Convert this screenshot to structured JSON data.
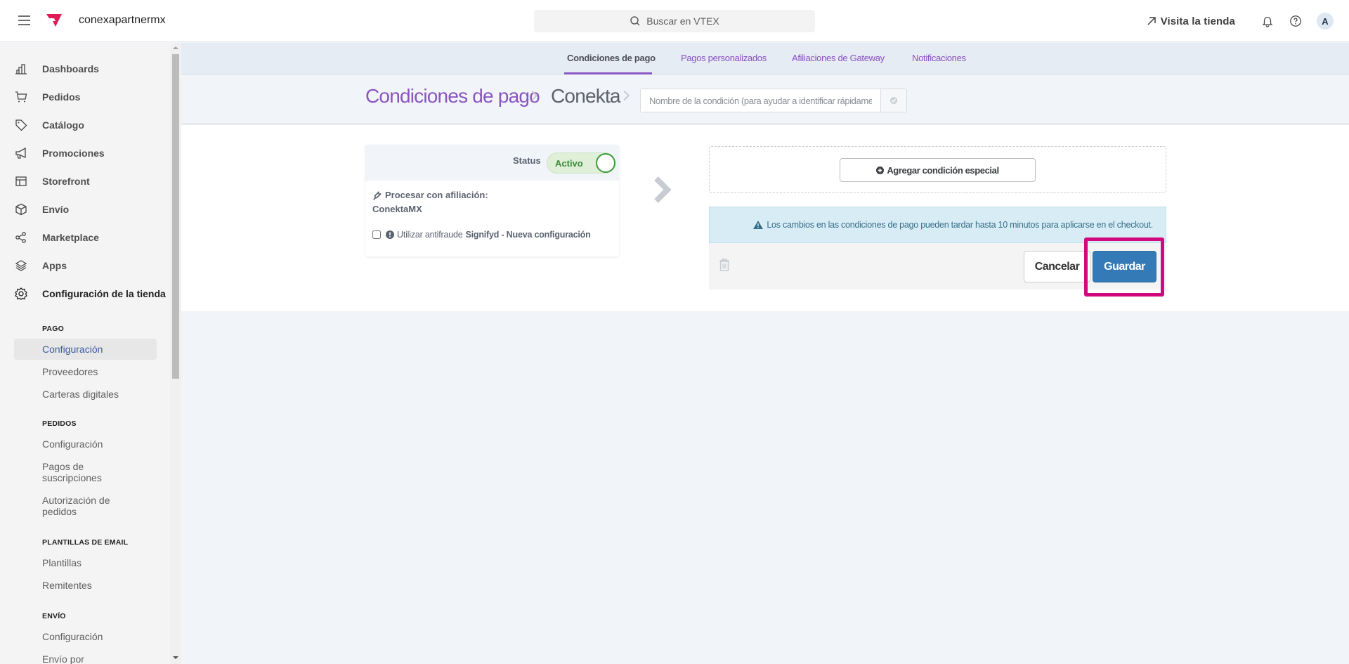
{
  "topbar": {
    "account_name": "conexapartnermx",
    "search_placeholder": "Buscar en VTEX",
    "visit_store_label": "Visita la tienda",
    "avatar_initial": "A",
    "brand_color": "#e31c58"
  },
  "sidebar": {
    "items": [
      {
        "label": "Dashboards",
        "icon": "bar-chart-icon"
      },
      {
        "label": "Pedidos",
        "icon": "cart-icon"
      },
      {
        "label": "Catálogo",
        "icon": "tag-icon"
      },
      {
        "label": "Promociones",
        "icon": "megaphone-icon"
      },
      {
        "label": "Storefront",
        "icon": "layout-icon"
      },
      {
        "label": "Envío",
        "icon": "box-icon"
      },
      {
        "label": "Marketplace",
        "icon": "share-nodes-icon"
      },
      {
        "label": "Apps",
        "icon": "layers-icon"
      },
      {
        "label": "Configuración de la tienda",
        "icon": "gear-icon",
        "active": true
      }
    ],
    "sections": [
      {
        "title": "PAGO",
        "items": [
          "Configuración",
          "Proveedores",
          "Carteras digitales"
        ],
        "active_index": 0
      },
      {
        "title": "PEDIDOS",
        "items": [
          "Configuración",
          "Pagos de suscripciones",
          "Autorización de pedidos"
        ]
      },
      {
        "title": "PLANTILLAS DE EMAIL",
        "items": [
          "Plantillas",
          "Remitentes"
        ]
      },
      {
        "title": "ENVÍO",
        "items": [
          "Configuración",
          "Envío por"
        ]
      }
    ]
  },
  "tabs": [
    {
      "label": "Condiciones de pago",
      "active": true
    },
    {
      "label": "Pagos personalizados"
    },
    {
      "label": "Afiliaciones de Gateway"
    },
    {
      "label": "Notificaciones"
    }
  ],
  "breadcrumb": {
    "root": "Condiciones de pago",
    "current": "Conekta",
    "name_input_value": "",
    "name_input_placeholder": "Nombre de la condición (para ayudar a identificar rápidamente)"
  },
  "rule_card": {
    "status_label": "Status",
    "status_value": "Activo",
    "status_on": true,
    "affiliation_label": "Procesar con afiliación:",
    "affiliation_name": "ConektaMX",
    "antifraud_prefix": "Utilizar antifraude",
    "antifraud_name": "Signifyd - Nueva configuración",
    "antifraud_checked": false
  },
  "special": {
    "add_button_label": "Agregar condición especial"
  },
  "alert": {
    "text": "Los cambios en las condiciones de pago pueden tardar hasta 10 minutos para aplicarse en el checkout."
  },
  "actions": {
    "cancel_label": "Cancelar",
    "save_label": "Guardar",
    "highlight_color": "#d2087f"
  }
}
